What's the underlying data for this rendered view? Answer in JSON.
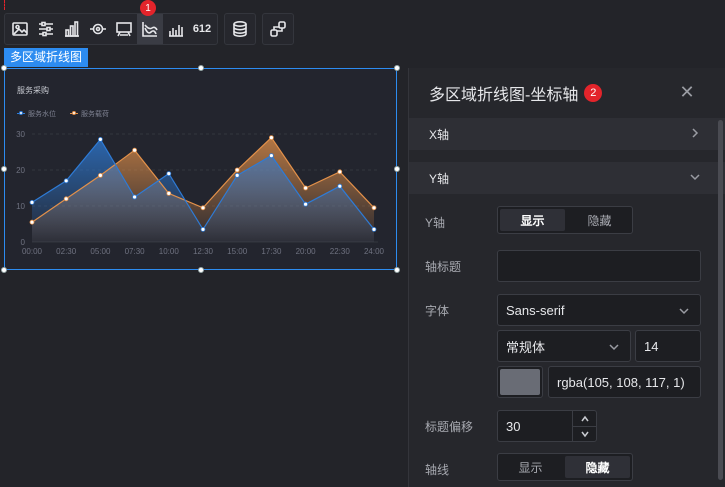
{
  "toolbar": {
    "group1_icons": [
      "image-icon",
      "sliders-icon",
      "bar-chart-icon",
      "target-icon",
      "screen-icon",
      "line-chart-icon",
      "bar-chart-alt-icon",
      "number-612-icon"
    ],
    "number_icon_text": "612",
    "group2_icons": [
      "database-icon"
    ],
    "group3_icons": [
      "share-icon"
    ],
    "badge1": "1"
  },
  "component": {
    "tag": "多区域折线图"
  },
  "chart_data": {
    "type": "area",
    "title": "服务采购",
    "legend": [
      "服务水位",
      "服务载荷"
    ],
    "x": [
      "00:00",
      "02:30",
      "05:00",
      "07:30",
      "10:00",
      "12:30",
      "15:00",
      "17:30",
      "20:00",
      "22:30",
      "24:00"
    ],
    "ylim": [
      0,
      30
    ],
    "yticks": [
      0,
      10,
      20,
      30
    ],
    "grid": true,
    "legend_placement": "top-left",
    "series": [
      {
        "name": "服务水位",
        "color": "#2e7bd6",
        "values": [
          11,
          17,
          28.5,
          12.5,
          19,
          3.5,
          18.5,
          24,
          10.5,
          15.5,
          3.5
        ]
      },
      {
        "name": "服务载荷",
        "color": "#e3914a",
        "values": [
          5.5,
          12,
          18.5,
          25.5,
          13.5,
          9.5,
          20,
          29,
          15,
          19.5,
          9.5
        ]
      }
    ]
  },
  "panel": {
    "title": "多区域折线图-坐标轴",
    "badge2": "2",
    "section_x": "X轴",
    "section_y": "Y轴",
    "y_axis_label": "Y轴",
    "show": "显示",
    "hide": "隐藏",
    "axis_title_label": "轴标题",
    "axis_title_value": "",
    "font_label": "字体",
    "font_family": "Sans-serif",
    "font_weight": "常规体",
    "font_size": "14",
    "font_color_hex": "#696c75",
    "font_color": "rgba(105, 108, 117, 1)",
    "title_offset_label": "标题偏移",
    "title_offset": "30",
    "axis_line_label": "轴线",
    "axis_line_show": "显示",
    "axis_line_hide": "隐藏"
  }
}
